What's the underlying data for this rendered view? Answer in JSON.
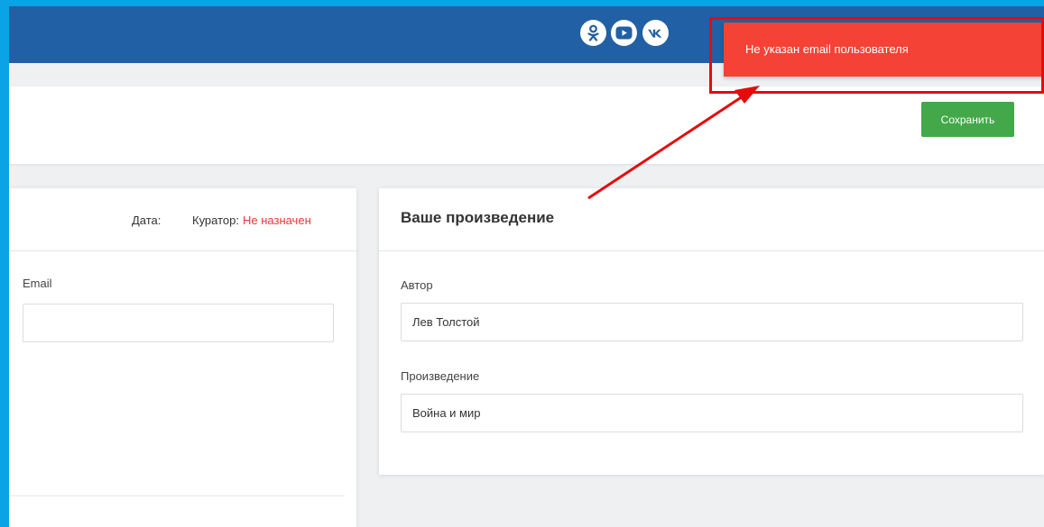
{
  "header": {
    "social_icons": [
      "odnoklassniki-icon",
      "youtube-icon",
      "vk-icon"
    ]
  },
  "toolbar": {
    "save_label": "Сохранить"
  },
  "left_card": {
    "date_label": "Дата:",
    "curator_label": "Куратор:",
    "curator_value": "Не назначен",
    "email_label": "Email",
    "email_value": ""
  },
  "right_card": {
    "title": "Ваше произведение",
    "author_label": "Автор",
    "author_value": "Лев Толстой",
    "work_label": "Произведение",
    "work_value": "Война и мир"
  },
  "notification": {
    "message": "Не указан email пользователя"
  },
  "colors": {
    "topbar": "#2160a4",
    "save_button": "#43a84a",
    "toast": "#f44336",
    "annotation": "#e60b0b",
    "curator_unassigned": "#e53935"
  }
}
